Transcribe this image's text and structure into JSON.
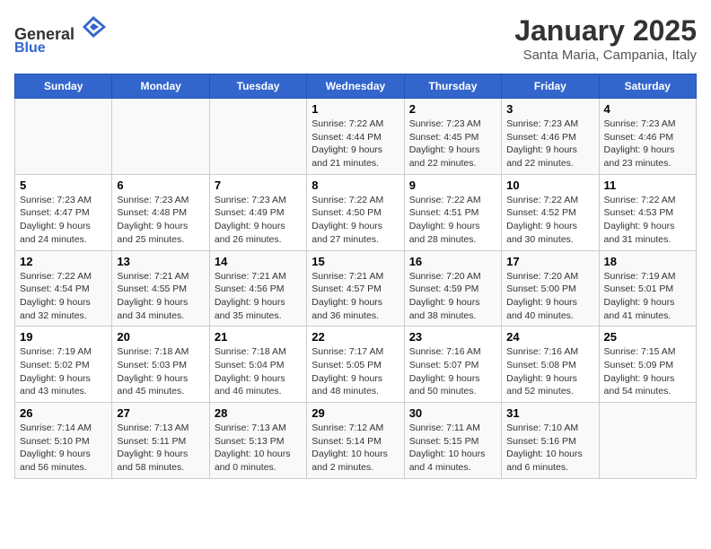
{
  "header": {
    "logo": {
      "general": "General",
      "blue": "Blue"
    },
    "title": "January 2025",
    "location": "Santa Maria, Campania, Italy"
  },
  "weekdays": [
    "Sunday",
    "Monday",
    "Tuesday",
    "Wednesday",
    "Thursday",
    "Friday",
    "Saturday"
  ],
  "weeks": [
    [
      {
        "day": null,
        "info": null
      },
      {
        "day": null,
        "info": null
      },
      {
        "day": null,
        "info": null
      },
      {
        "day": "1",
        "sunrise": "7:22 AM",
        "sunset": "4:44 PM",
        "daylight": "9 hours and 21 minutes."
      },
      {
        "day": "2",
        "sunrise": "7:23 AM",
        "sunset": "4:45 PM",
        "daylight": "9 hours and 22 minutes."
      },
      {
        "day": "3",
        "sunrise": "7:23 AM",
        "sunset": "4:46 PM",
        "daylight": "9 hours and 22 minutes."
      },
      {
        "day": "4",
        "sunrise": "7:23 AM",
        "sunset": "4:46 PM",
        "daylight": "9 hours and 23 minutes."
      }
    ],
    [
      {
        "day": "5",
        "sunrise": "7:23 AM",
        "sunset": "4:47 PM",
        "daylight": "9 hours and 24 minutes."
      },
      {
        "day": "6",
        "sunrise": "7:23 AM",
        "sunset": "4:48 PM",
        "daylight": "9 hours and 25 minutes."
      },
      {
        "day": "7",
        "sunrise": "7:23 AM",
        "sunset": "4:49 PM",
        "daylight": "9 hours and 26 minutes."
      },
      {
        "day": "8",
        "sunrise": "7:22 AM",
        "sunset": "4:50 PM",
        "daylight": "9 hours and 27 minutes."
      },
      {
        "day": "9",
        "sunrise": "7:22 AM",
        "sunset": "4:51 PM",
        "daylight": "9 hours and 28 minutes."
      },
      {
        "day": "10",
        "sunrise": "7:22 AM",
        "sunset": "4:52 PM",
        "daylight": "9 hours and 30 minutes."
      },
      {
        "day": "11",
        "sunrise": "7:22 AM",
        "sunset": "4:53 PM",
        "daylight": "9 hours and 31 minutes."
      }
    ],
    [
      {
        "day": "12",
        "sunrise": "7:22 AM",
        "sunset": "4:54 PM",
        "daylight": "9 hours and 32 minutes."
      },
      {
        "day": "13",
        "sunrise": "7:21 AM",
        "sunset": "4:55 PM",
        "daylight": "9 hours and 34 minutes."
      },
      {
        "day": "14",
        "sunrise": "7:21 AM",
        "sunset": "4:56 PM",
        "daylight": "9 hours and 35 minutes."
      },
      {
        "day": "15",
        "sunrise": "7:21 AM",
        "sunset": "4:57 PM",
        "daylight": "9 hours and 36 minutes."
      },
      {
        "day": "16",
        "sunrise": "7:20 AM",
        "sunset": "4:59 PM",
        "daylight": "9 hours and 38 minutes."
      },
      {
        "day": "17",
        "sunrise": "7:20 AM",
        "sunset": "5:00 PM",
        "daylight": "9 hours and 40 minutes."
      },
      {
        "day": "18",
        "sunrise": "7:19 AM",
        "sunset": "5:01 PM",
        "daylight": "9 hours and 41 minutes."
      }
    ],
    [
      {
        "day": "19",
        "sunrise": "7:19 AM",
        "sunset": "5:02 PM",
        "daylight": "9 hours and 43 minutes."
      },
      {
        "day": "20",
        "sunrise": "7:18 AM",
        "sunset": "5:03 PM",
        "daylight": "9 hours and 45 minutes."
      },
      {
        "day": "21",
        "sunrise": "7:18 AM",
        "sunset": "5:04 PM",
        "daylight": "9 hours and 46 minutes."
      },
      {
        "day": "22",
        "sunrise": "7:17 AM",
        "sunset": "5:05 PM",
        "daylight": "9 hours and 48 minutes."
      },
      {
        "day": "23",
        "sunrise": "7:16 AM",
        "sunset": "5:07 PM",
        "daylight": "9 hours and 50 minutes."
      },
      {
        "day": "24",
        "sunrise": "7:16 AM",
        "sunset": "5:08 PM",
        "daylight": "9 hours and 52 minutes."
      },
      {
        "day": "25",
        "sunrise": "7:15 AM",
        "sunset": "5:09 PM",
        "daylight": "9 hours and 54 minutes."
      }
    ],
    [
      {
        "day": "26",
        "sunrise": "7:14 AM",
        "sunset": "5:10 PM",
        "daylight": "9 hours and 56 minutes."
      },
      {
        "day": "27",
        "sunrise": "7:13 AM",
        "sunset": "5:11 PM",
        "daylight": "9 hours and 58 minutes."
      },
      {
        "day": "28",
        "sunrise": "7:13 AM",
        "sunset": "5:13 PM",
        "daylight": "10 hours and 0 minutes."
      },
      {
        "day": "29",
        "sunrise": "7:12 AM",
        "sunset": "5:14 PM",
        "daylight": "10 hours and 2 minutes."
      },
      {
        "day": "30",
        "sunrise": "7:11 AM",
        "sunset": "5:15 PM",
        "daylight": "10 hours and 4 minutes."
      },
      {
        "day": "31",
        "sunrise": "7:10 AM",
        "sunset": "5:16 PM",
        "daylight": "10 hours and 6 minutes."
      },
      {
        "day": null,
        "info": null
      }
    ]
  ]
}
